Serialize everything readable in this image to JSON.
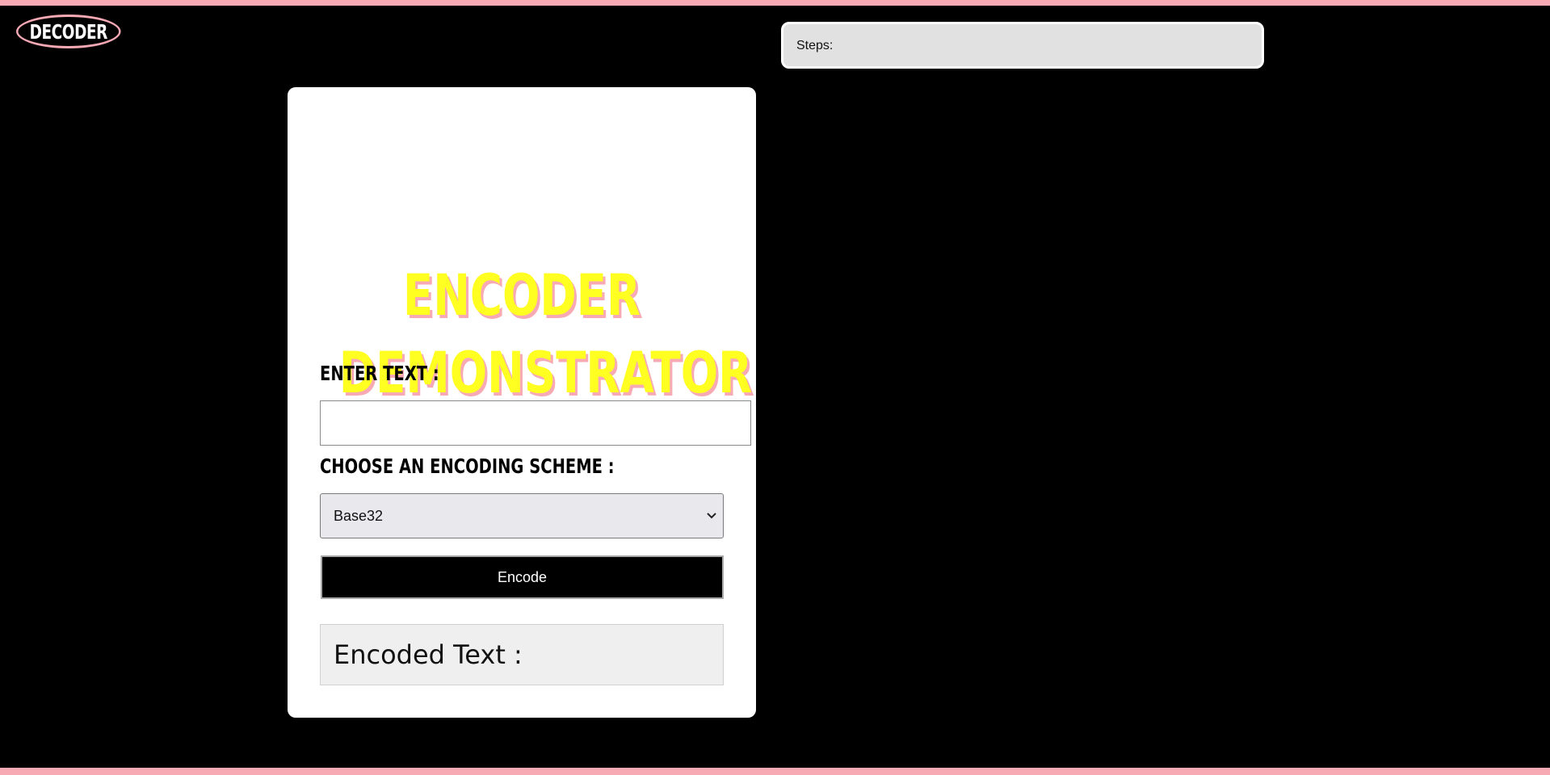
{
  "header": {
    "logo_button_label": "DECODER",
    "steps_label": "Steps:"
  },
  "card": {
    "title_line1": "ENCODER",
    "title_line2": "DEMONSTRATOR",
    "enter_text_label": "ENTER TEXT :",
    "text_input_value": "",
    "choose_scheme_label": "CHOOSE AN ENCODING SCHEME :",
    "scheme_selected": "Base32",
    "encode_button_label": "Encode",
    "result_label": "Encoded Text :"
  },
  "colors": {
    "accent_pink": "#f7a9b4",
    "title_yellow": "#ffff22",
    "background": "#000000"
  }
}
